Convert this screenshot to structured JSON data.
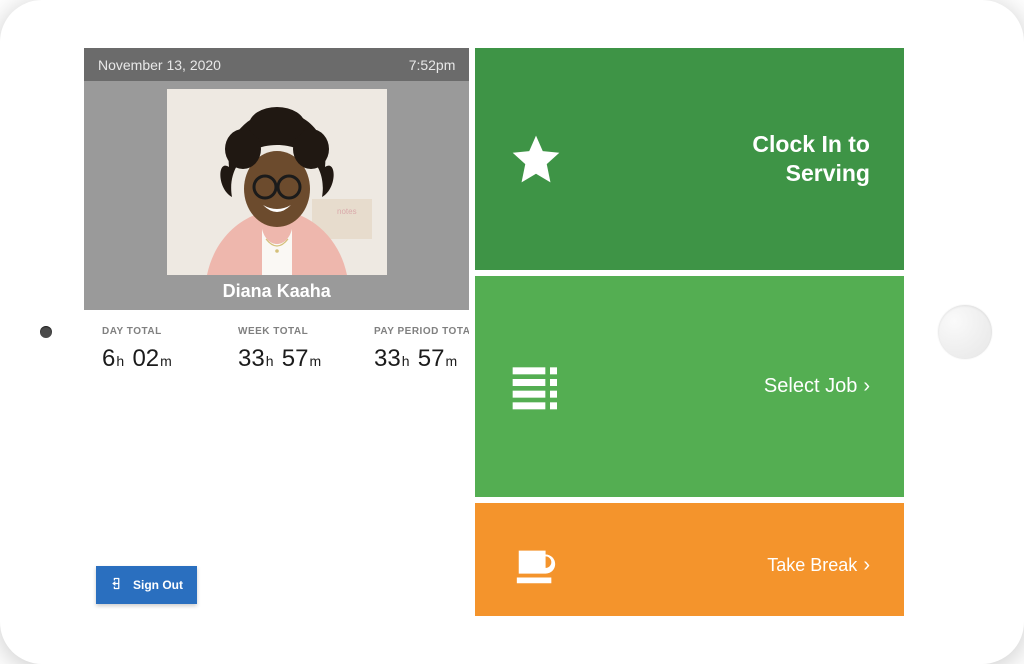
{
  "status": {
    "date": "November 13, 2020",
    "time": "7:52pm"
  },
  "employee": {
    "name": "Diana Kaaha"
  },
  "totals": [
    {
      "label": "DAY TOTAL",
      "hours": "6",
      "minutes": "02"
    },
    {
      "label": "WEEK TOTAL",
      "hours": "33",
      "minutes": "57"
    },
    {
      "label": "PAY PERIOD TOTAL",
      "hours": "33",
      "minutes": "57"
    }
  ],
  "actions": {
    "clock_in": {
      "label": "Clock In to Serving"
    },
    "select_job": {
      "label": "Select Job"
    },
    "take_break": {
      "label": "Take Break"
    }
  },
  "signout": {
    "label": "Sign Out"
  },
  "colors": {
    "dark_green": "#3e9446",
    "green": "#54ae52",
    "orange": "#f4942c",
    "blue": "#2a6fbf"
  }
}
